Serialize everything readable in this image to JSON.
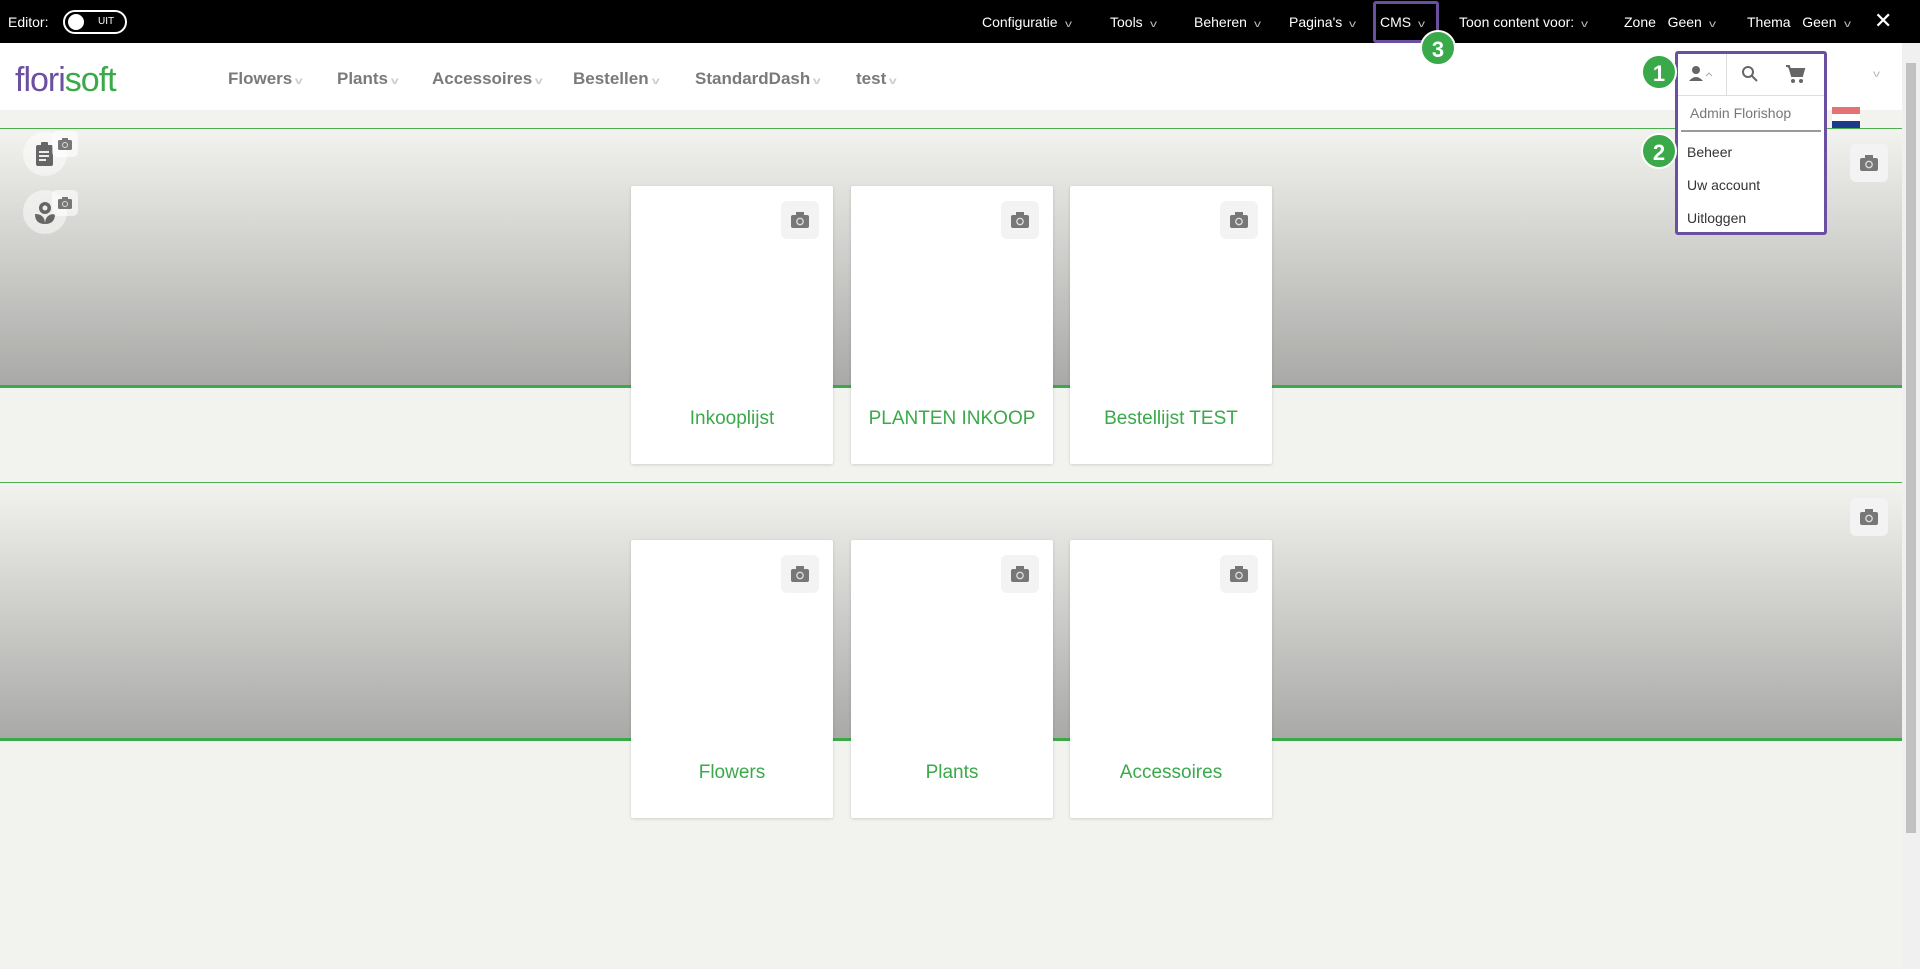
{
  "topbar": {
    "editor_label": "Editor:",
    "editor_toggle": "UIT",
    "menus": [
      "Configuratie",
      "Tools",
      "Beheren",
      "Pagina's",
      "CMS",
      "Toon content voor:"
    ],
    "zone_label": "Zone",
    "zone_value": "Geen",
    "thema_label": "Thema",
    "thema_value": "Geen",
    "close": "✕"
  },
  "badges": [
    "1",
    "2",
    "3"
  ],
  "header": {
    "logo_a": "flori",
    "logo_b": "soft",
    "nav": [
      "Flowers",
      "Plants",
      "Accessoires",
      "Bestellen",
      "StandardDash",
      "test"
    ]
  },
  "user_menu": {
    "name": "Admin Florishop",
    "items": [
      "Beheer",
      "Uw account",
      "Uitloggen"
    ]
  },
  "sections": [
    {
      "cards": [
        "Inkooplijst",
        "PLANTEN INKOOP",
        "Bestellijst TEST"
      ]
    },
    {
      "cards": [
        "Flowers",
        "Plants",
        "Accessoires"
      ]
    }
  ],
  "colors": {
    "green": "#3aa94a",
    "purple": "#6b4fa0"
  }
}
